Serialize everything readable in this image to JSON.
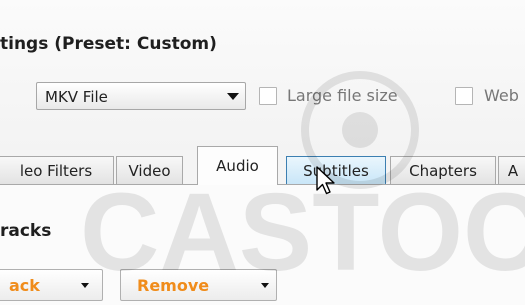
{
  "settings": {
    "title": "tings (Preset: Custom)",
    "container": {
      "value": "MKV File"
    },
    "large_file_size": {
      "label": "Large file size",
      "checked": false
    },
    "web_optimized": {
      "label": "Web",
      "checked": false
    }
  },
  "tabs": [
    {
      "label": "leo Filters",
      "active": false
    },
    {
      "label": "Video",
      "active": false
    },
    {
      "label": "Audio",
      "active": true
    },
    {
      "label": "Subtitles",
      "active": false,
      "hover": true
    },
    {
      "label": "Chapters",
      "active": false
    },
    {
      "label": "A",
      "active": false
    }
  ],
  "audio": {
    "section_label": "racks",
    "add_button": {
      "label": "ack"
    },
    "remove_button": {
      "label": "Remove"
    }
  },
  "colors": {
    "accent_orange": "#f08c1b",
    "hover_blue": "#3c7fb1"
  },
  "icons": {
    "cursor": "arrow-cursor-icon",
    "watermark": "watermark-logo"
  }
}
